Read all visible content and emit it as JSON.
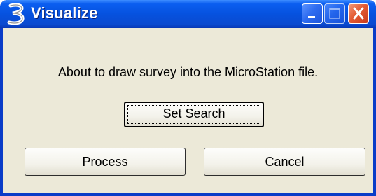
{
  "window": {
    "title": "Visualize",
    "icon": "microstation-b-icon",
    "controls": {
      "minimize_icon": "minimize-icon",
      "maximize_icon": "maximize-icon",
      "close_icon": "close-icon"
    }
  },
  "dialog": {
    "message": "About to draw survey into the MicroStation file.",
    "buttons": {
      "set_search": "Set Search",
      "process": "Process",
      "cancel": "Cancel"
    }
  },
  "colors": {
    "titlebar": "#0652df",
    "close_button": "#e35b34",
    "dialog_background": "#ece9d8"
  }
}
